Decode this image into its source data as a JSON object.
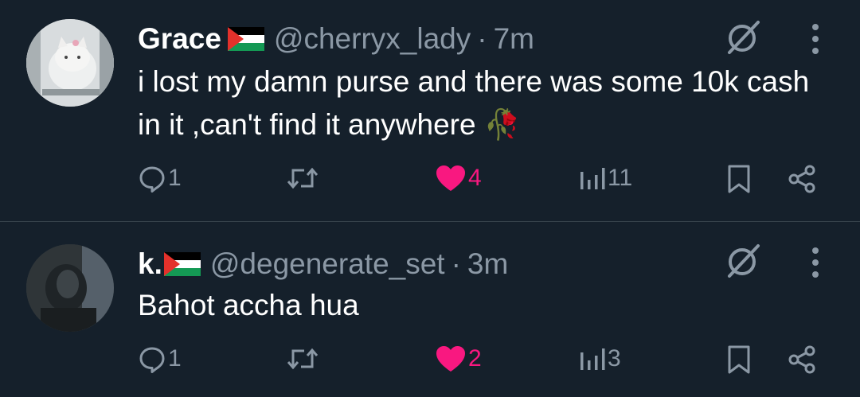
{
  "tweets": [
    {
      "name": "Grace",
      "handle": "@cherryx_lady",
      "separator": "·",
      "time": "7m",
      "text": "i lost my damn purse and there was some 10k cash in it ,can't find it anywhere 🥀",
      "replies": "1",
      "likes": "4",
      "views": "11",
      "liked": true
    },
    {
      "name": "k.",
      "handle": "@degenerate_set",
      "separator": "·",
      "time": "3m",
      "text": "Bahot accha hua",
      "replies": "1",
      "likes": "2",
      "views": "3",
      "liked": true
    }
  ],
  "colors": {
    "background": "#15202b",
    "secondary_text": "#8b98a5",
    "like_pink": "#f91880",
    "divider": "#38444d"
  },
  "icons": [
    "palestine-flag-icon",
    "grok-icon",
    "more-icon",
    "reply-icon",
    "retweet-icon",
    "like-icon",
    "views-icon",
    "bookmark-icon",
    "share-icon"
  ]
}
